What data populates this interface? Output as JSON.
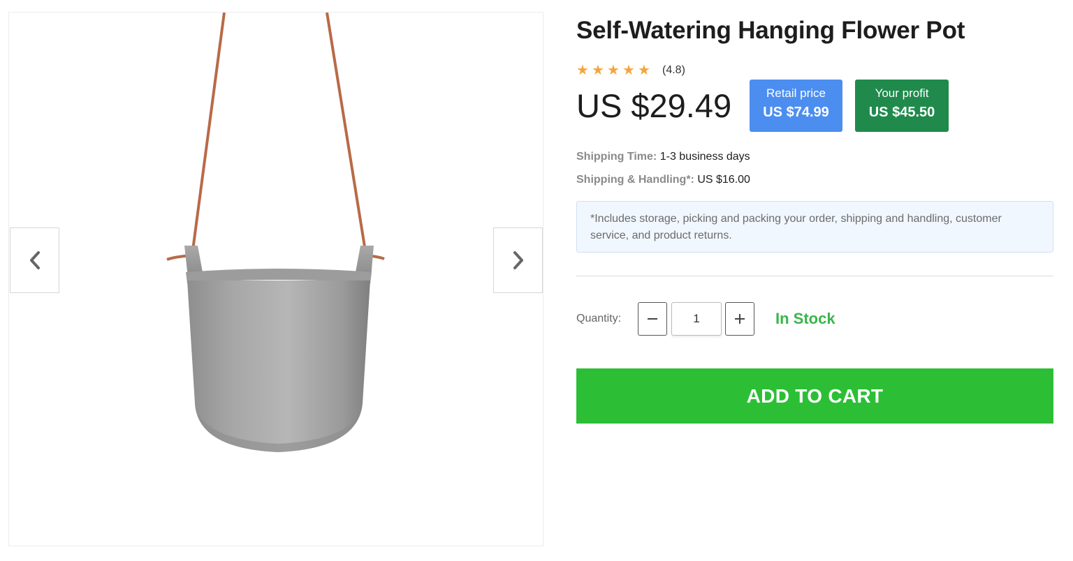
{
  "product": {
    "title": "Self-Watering Hanging Flower Pot",
    "rating": {
      "stars_filled": 5,
      "value_text": "(4.8)",
      "star_color": "#f6a53d"
    },
    "price": "US $29.49",
    "retail": {
      "label": "Retail price",
      "amount": "US $74.99",
      "color": "#4c8ef0"
    },
    "profit": {
      "label": "Your profit",
      "amount": "US $45.50",
      "color": "#1f8a4c"
    }
  },
  "shipping": {
    "time_label": "Shipping Time:",
    "time_value": "1-3 business days",
    "handling_label": "Shipping & Handling*:",
    "handling_value": "US $16.00",
    "note": "*Includes storage, picking and packing your order, shipping and handling, customer service, and product returns."
  },
  "quantity": {
    "label": "Quantity:",
    "value": "1",
    "minus_icon": "minus-icon",
    "plus_icon": "plus-icon"
  },
  "stock": {
    "text": "In Stock",
    "color": "#39b54a"
  },
  "cart": {
    "button_label": "ADD TO CART",
    "color": "#2cbf35"
  },
  "gallery": {
    "prev_icon": "chevron-left-icon",
    "next_icon": "chevron-right-icon"
  }
}
